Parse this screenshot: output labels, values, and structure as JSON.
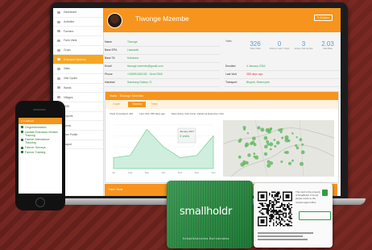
{
  "sidebar": {
    "items": [
      {
        "label": "Dashboard",
        "active": false
      },
      {
        "label": "Activities",
        "active": false
      },
      {
        "label": "Farmers",
        "active": false
      },
      {
        "label": "Farm Visits",
        "active": false
      },
      {
        "label": "Crops",
        "active": false
      },
      {
        "label": "Extension Workers",
        "active": true
      },
      {
        "label": "Visits",
        "active": false
      },
      {
        "label": "Visit Cycles",
        "active": false
      },
      {
        "label": "Wards",
        "active": false
      },
      {
        "label": "Villages",
        "active": false
      },
      {
        "label": "SMS",
        "active": false
      },
      {
        "label": "Reports",
        "active": false
      },
      {
        "label": "Admin",
        "active": false
      },
      {
        "label": "User Profile",
        "active": false
      },
      {
        "label": "Logout",
        "active": false
      }
    ]
  },
  "header": {
    "name": "Tiwonge Mzembe",
    "action_label": "Actions"
  },
  "details": [
    {
      "key": "Name",
      "value": "Tiwonge"
    },
    {
      "key": "Base EPA",
      "value": "Lisasadzi"
    },
    {
      "key": "Base TA",
      "value": "Kaluluma"
    },
    {
      "key": "Email",
      "value": "tiwonge.mzembe@gmail.com"
    },
    {
      "key": "Phone",
      "value": "+265991480152 · Send SMS"
    },
    {
      "key": "Handset",
      "value": "Samsung Galaxy J1"
    }
  ],
  "details2": [
    {
      "key": "Enrolled",
      "value": "4 January 2016",
      "green": true
    },
    {
      "key": "Last Visit",
      "value": "355 days ago",
      "green": false
    },
    {
      "key": "Transport",
      "value": "Bicycle, Motorcycle",
      "green": true
    }
  ],
  "stats": {
    "label": "Visits",
    "items": [
      {
        "num": "326",
        "lbl": "Total Visits"
      },
      {
        "num": "0",
        "lbl": "Visits in Last 7 days"
      },
      {
        "num": "3",
        "lbl": "Active Visit Cycles"
      },
      {
        "num": "2.03",
        "lbl": "Visit Rate"
      }
    ]
  },
  "panel": {
    "title": "Visits · Tiwonge Mzembe",
    "tabs": [
      "Graph",
      "Timeline",
      "Visits"
    ],
    "active_tab": 1,
    "legend": [
      "Visits Completed: 326",
      "Last Visit: 355 days ago",
      "Most Active Visit Cycle: Kaluluma Extension Visit"
    ],
    "tooltip": {
      "line1": "January 2017",
      "line2": "3 visits"
    }
  },
  "footer": {
    "label": "Farm Visits"
  },
  "phone": {
    "bar_label": "smallholdr",
    "items": [
      "Ongoinformation",
      "Update Extension Worker Training",
      "Farmer Attendance Tracking",
      "Farmer Surveys",
      "Farmer Training"
    ]
  },
  "card": {
    "brand": "smallholdr",
    "sub": "Kebadikhanizima Barindolakea"
  },
  "qrcard": {
    "text": "This card is the property of Smallholdr. If found please return to the nearest agent office."
  },
  "chart_data": {
    "type": "area",
    "x": [
      "Jul",
      "Aug",
      "Sep",
      "Oct",
      "Nov",
      "Dec",
      "Jan"
    ],
    "values": [
      1,
      1.2,
      3.6,
      2,
      1,
      1.2,
      3
    ],
    "ylim": [
      0,
      4
    ]
  },
  "colors": {
    "accent": "#f7941d",
    "green": "#2e9e43",
    "chart_fill": "#cfeedd"
  }
}
